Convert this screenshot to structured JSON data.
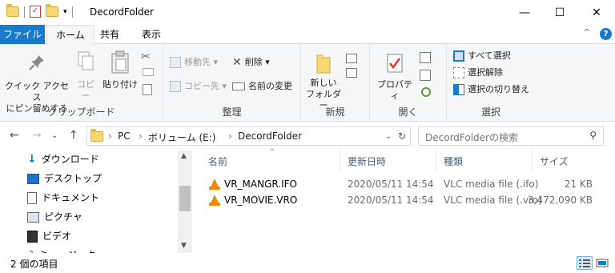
{
  "window": {
    "title": "DecordFolder",
    "minimize": "—",
    "maximize": "☐",
    "close": "✕"
  },
  "tabs": {
    "file": "ファイル",
    "home": "ホーム",
    "share": "共有",
    "view": "表示"
  },
  "ribbon_controls": {
    "collapse": "^",
    "help": "?"
  },
  "ribbon": {
    "clipboard": {
      "label": "クリップボード",
      "pin_line1": "クイック アクセス",
      "pin_line2": "にピン留めする",
      "copy": "コピー",
      "paste": "貼り付け"
    },
    "organize": {
      "label": "整理",
      "move_to": "移動先 ▾",
      "copy_to": "コピー先 ▾",
      "delete": "削除 ▾",
      "rename": "名前の変更"
    },
    "new": {
      "label": "新規",
      "new_folder_line1": "新しい",
      "new_folder_line2": "フォルダー"
    },
    "open": {
      "label": "開く",
      "properties": "プロパティ"
    },
    "select": {
      "label": "選択",
      "select_all": "すべて選択",
      "select_none": "選択解除",
      "invert": "選択の切り替え"
    }
  },
  "address": {
    "crumbs": [
      "PC",
      "ボリューム (E:)",
      "DecordFolder"
    ],
    "search_placeholder": "DecordFolderの検索"
  },
  "nav": {
    "items": [
      {
        "label": "ダウンロード",
        "icon": "download-arrow-icon",
        "color": "#1e73c8"
      },
      {
        "label": "デスクトップ",
        "icon": "desktop-icon",
        "color": "#1e73c8"
      },
      {
        "label": "ドキュメント",
        "icon": "document-icon",
        "color": "#666666"
      },
      {
        "label": "ピクチャ",
        "icon": "picture-icon",
        "color": "#666666"
      },
      {
        "label": "ビデオ",
        "icon": "video-icon",
        "color": "#333333"
      },
      {
        "label": "ミュージック",
        "icon": "music-icon",
        "color": "#1e73c8"
      }
    ]
  },
  "columns": {
    "name": "名前",
    "date": "更新日時",
    "type": "種類",
    "size": "サイズ"
  },
  "files": [
    {
      "name": "VR_MANGR.IFO",
      "date": "2020/05/11 14:54",
      "type": "VLC media file (.ifo)",
      "size": "21 KB"
    },
    {
      "name": "VR_MOVIE.VRO",
      "date": "2020/05/11 14:54",
      "type": "VLC media file (.vro)",
      "size": "3,472,090 KB"
    }
  ],
  "status": {
    "count": "2 個の項目"
  },
  "colors": {
    "accent": "#1979ca",
    "vlc_orange": "#f08a00",
    "header_text": "#4c607a"
  }
}
